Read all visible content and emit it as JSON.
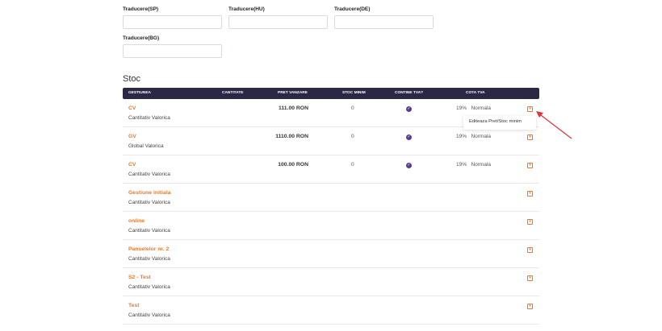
{
  "form": {
    "fields": [
      {
        "label": "Traducere(SP)",
        "value": ""
      },
      {
        "label": "Traducere(HU)",
        "value": ""
      },
      {
        "label": "Traducere(DE)",
        "value": ""
      },
      {
        "label": "Traducere(BG)",
        "value": ""
      }
    ]
  },
  "stock": {
    "title": "Stoc",
    "columns": [
      "GESTIUNEA",
      "CANTITATE",
      "PRET VANZARE",
      "STOC MINIM",
      "CONTINE TVA?",
      "COTA TVA"
    ],
    "rows": [
      {
        "name": "CV",
        "type": "Cantitativ Valorica",
        "price": "111.00 RON",
        "min_stock": "0",
        "includes_vat": true,
        "vat_rate": "19%",
        "vat_name": "Normala"
      },
      {
        "name": "GV",
        "type": "Global Valorica",
        "price": "1110.00 RON",
        "min_stock": "0",
        "includes_vat": true,
        "vat_rate": "19%",
        "vat_name": "Normala"
      },
      {
        "name": "CV",
        "type": "Cantitativ Valorica",
        "price": "100.00 RON",
        "min_stock": "0",
        "includes_vat": true,
        "vat_rate": "19%",
        "vat_name": "Normala"
      },
      {
        "name": "Gestiune initiala",
        "type": "Cantitativ Valorica"
      },
      {
        "name": "online",
        "type": "Cantitativ Valorica"
      },
      {
        "name": "Panselelor nr. 2",
        "type": "Cantitativ Valorica"
      },
      {
        "name": "S2 - Test",
        "type": "Cantitativ Valorica"
      },
      {
        "name": "Test",
        "type": "Cantitativ Valorica"
      }
    ],
    "dropdown_menu": {
      "item": "Editeaza Pret/Stoc minim"
    }
  },
  "colors": {
    "accent": "#e57a2f",
    "header_bg": "#2b2845",
    "check": "#5b3c8c",
    "annotation_arrow": "#d9363e"
  },
  "icons": {
    "row_action": "chevron-down-icon",
    "vat_included": "check-circle-icon"
  }
}
